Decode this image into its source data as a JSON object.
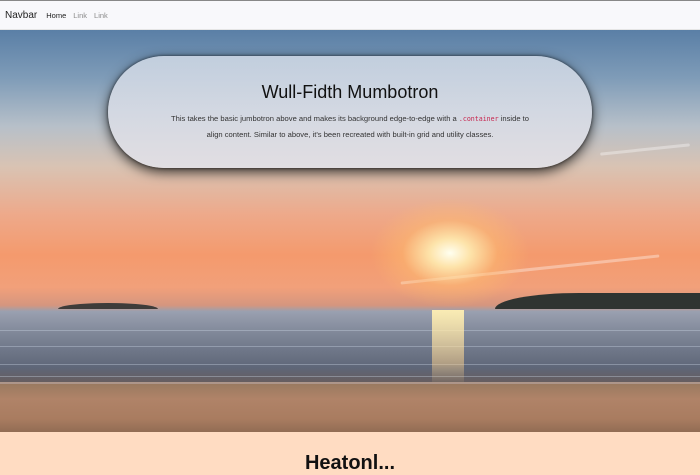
{
  "navbar": {
    "brand": "Navbar",
    "links": [
      {
        "label": "Home",
        "active": true
      },
      {
        "label": "Link",
        "active": false
      },
      {
        "label": "Link",
        "active": false
      }
    ]
  },
  "jumbotron": {
    "title": "Wull-Fidth Mumbotron",
    "text_before_code": "This takes the basic jumbotron above and makes its background edge-to-edge with a ",
    "code": ".container",
    "text_after_code": " inside to align content. Similar to above, it's been recreated with built-in grid and utility classes."
  },
  "hero_image": {
    "subject": "sunset-over-sea-beach"
  },
  "next_section": {
    "heading": "Heatonl..."
  },
  "colors": {
    "page_bg": "#ffdcc2",
    "navbar_bg": "#f8f8fb",
    "code_color": "#c7254e"
  }
}
